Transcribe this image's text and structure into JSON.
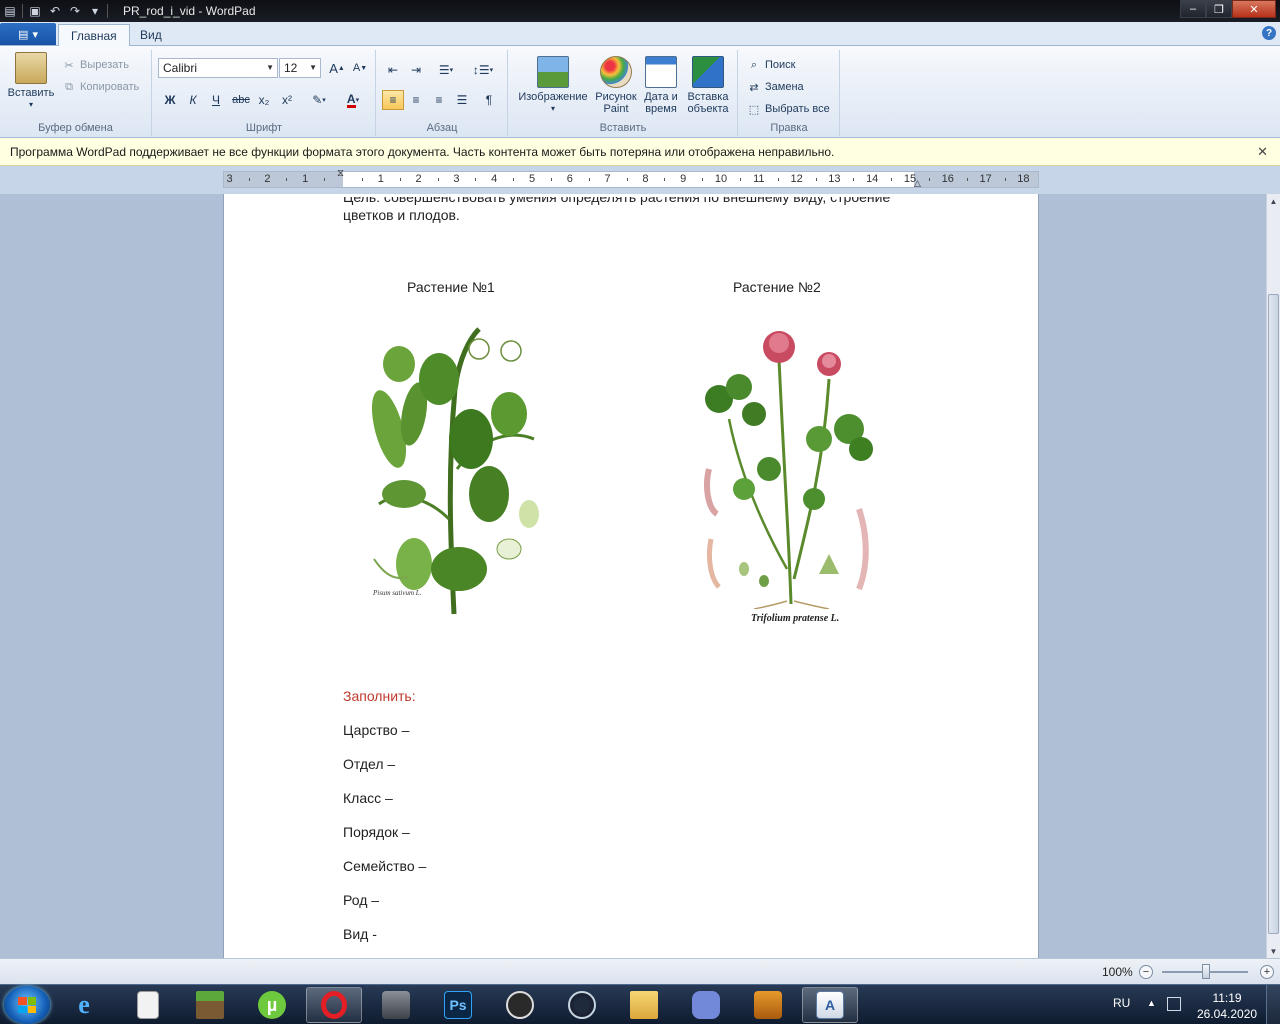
{
  "window": {
    "title": "PR_rod_i_vid - WordPad",
    "minimize_glyph": "‒",
    "maximize_glyph": "❐",
    "close_glyph": "✕"
  },
  "ribbon": {
    "tabs": [
      {
        "label": "Главная",
        "active": true
      },
      {
        "label": "Вид",
        "active": false
      }
    ],
    "clipboard": {
      "label": "Буфер обмена",
      "paste": "Вставить",
      "cut": "Вырезать",
      "copy": "Копировать"
    },
    "font": {
      "label": "Шрифт",
      "family": "Calibri",
      "size": "12",
      "grow": "A",
      "shrink": "A",
      "bold": "Ж",
      "italic": "К",
      "underline": "Ч",
      "strike": "abc",
      "subscript": "x₂",
      "superscript": "x²",
      "color": "A"
    },
    "paragraph": {
      "label": "Абзац"
    },
    "insert": {
      "label": "Вставить",
      "image": "Изображение",
      "paint_line1": "Рисунок",
      "paint_line2": "Paint",
      "datetime_line1": "Дата и",
      "datetime_line2": "время",
      "object_line1": "Вставка",
      "object_line2": "объекта"
    },
    "editing": {
      "label": "Правка",
      "find": "Поиск",
      "replace": "Замена",
      "select_all": "Выбрать все"
    }
  },
  "infobar": {
    "message": "Программа WordPad поддерживает не все функции формата этого документа. Часть контента может быть потеряна или отображена неправильно.",
    "close": "✕"
  },
  "ruler": {
    "left_numbers": [
      "3",
      "2",
      "1"
    ],
    "right_numbers": [
      "1",
      "2",
      "3",
      "4",
      "5",
      "6",
      "7",
      "8",
      "9",
      "10",
      "11",
      "12",
      "13",
      "14",
      "15",
      "16",
      "17",
      "18"
    ]
  },
  "document": {
    "line_cut": "Цель: совершенствовать умения определять растения по внешнему виду, строение",
    "line2": "цветков и плодов.",
    "plant1_title": "Растение №1",
    "plant2_title": "Растение №2",
    "plant1_caption": "Pisum sativum L.",
    "plant2_caption": "Trifolium pratense L.",
    "fill_label": "Заполнить:",
    "taxonomy": [
      "Царство –",
      "Отдел –",
      "Класс –",
      "Порядок –",
      "Семейство –",
      "Род –",
      "Вид -"
    ]
  },
  "statusbar": {
    "zoom": "100%",
    "zoom_out": "−",
    "zoom_in": "+"
  },
  "taskbar": {
    "lang": "RU",
    "time": "11:19",
    "date": "26.04.2020",
    "items": [
      "explorer-ie",
      "notepad",
      "minecraft",
      "utorrent",
      "opera",
      "game-soldier",
      "photoshop",
      "obs",
      "steam",
      "file-explorer",
      "discord",
      "counter-strike",
      "wordpad"
    ]
  }
}
